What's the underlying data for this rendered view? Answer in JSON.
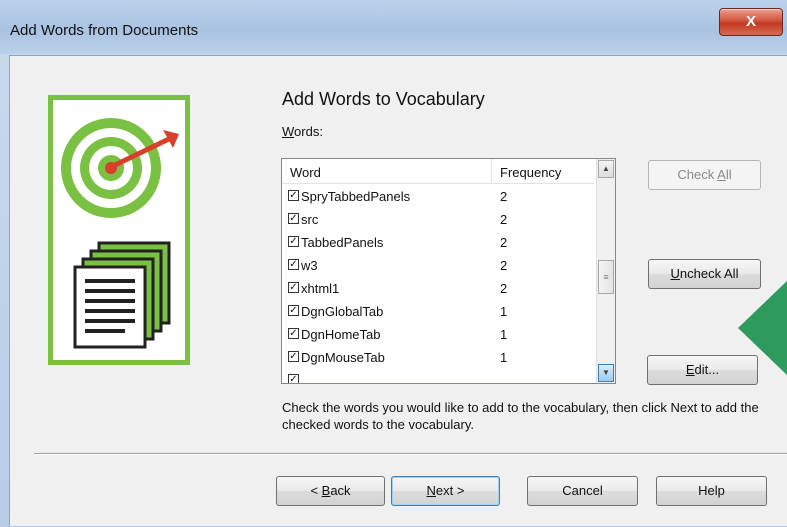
{
  "window": {
    "title": "Add Words from Documents",
    "close_label": "X"
  },
  "heading": "Add Words to Vocabulary",
  "words_label": {
    "mnemonic": "W",
    "rest": "ords:"
  },
  "list": {
    "columns": [
      "Word",
      "Frequency"
    ],
    "rows": [
      {
        "word": "SpryTabbedPanels",
        "freq": "2",
        "checked": true
      },
      {
        "word": "src",
        "freq": "2",
        "checked": true
      },
      {
        "word": "TabbedPanels",
        "freq": "2",
        "checked": true
      },
      {
        "word": "w3",
        "freq": "2",
        "checked": true
      },
      {
        "word": "xhtml1",
        "freq": "2",
        "checked": true
      },
      {
        "word": "DgnGlobalTab",
        "freq": "1",
        "checked": true
      },
      {
        "word": "DgnHomeTab",
        "freq": "1",
        "checked": true
      },
      {
        "word": "DgnMouseTab",
        "freq": "1",
        "checked": true
      }
    ]
  },
  "buttons": {
    "check_all": {
      "pre": "Check ",
      "mnemonic": "A",
      "post": "ll"
    },
    "uncheck_all": {
      "pre": "",
      "mnemonic": "U",
      "post": "ncheck All"
    },
    "edit": {
      "pre": "",
      "mnemonic": "E",
      "post": "dit..."
    },
    "back": {
      "pre": "< ",
      "mnemonic": "B",
      "post": "ack"
    },
    "next": {
      "pre": "",
      "mnemonic": "N",
      "post": "ext >"
    },
    "cancel": "Cancel",
    "help": "Help"
  },
  "hint": "Check the words you would like to add to the vocabulary, then click Next to add the checked words to the vocabulary.",
  "colors": {
    "accent_green": "#7ac143",
    "target_red": "#d9402b",
    "marker_green": "#2f9a5e"
  },
  "icons": [
    "target-icon",
    "documents-icon",
    "checkbox-icon",
    "scroll-up-icon",
    "scroll-down-icon"
  ]
}
